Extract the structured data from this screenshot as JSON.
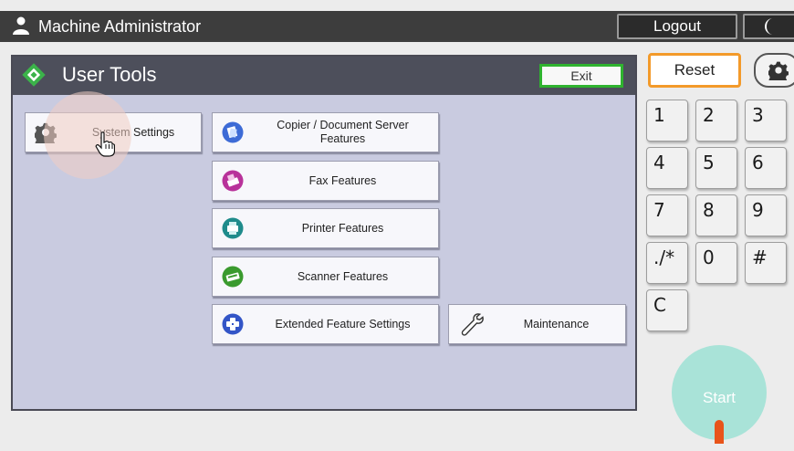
{
  "topbar": {
    "user_name": "Machine Administrator",
    "logout_label": "Logout"
  },
  "panel": {
    "title": "User Tools",
    "exit_label": "Exit",
    "buttons": {
      "system_settings": "System Settings",
      "copier": "Copier / Document Server Features",
      "fax": "Fax Features",
      "printer": "Printer Features",
      "scanner": "Scanner Features",
      "extended": "Extended Feature Settings",
      "maintenance": "Maintenance"
    }
  },
  "keypad": {
    "reset_label": "Reset",
    "keys": [
      "1",
      "2",
      "3",
      "4",
      "5",
      "6",
      "7",
      "8",
      "9",
      "./*",
      "0",
      "#",
      "C"
    ],
    "start_label": "Start"
  },
  "colors": {
    "topbar_bg": "#3d3d3d",
    "panel_bg": "#c9cbe0",
    "exit_border": "#2fb32f",
    "reset_border": "#f39a2a",
    "start_bg": "#a9e3d8",
    "start_indicator": "#e8541a",
    "copier_icon": "#3d6bd6",
    "fax_icon": "#b8329a",
    "printer_icon": "#1f8b8b",
    "scanner_icon": "#3a9a2e",
    "extended_icon": "#3355c7"
  }
}
